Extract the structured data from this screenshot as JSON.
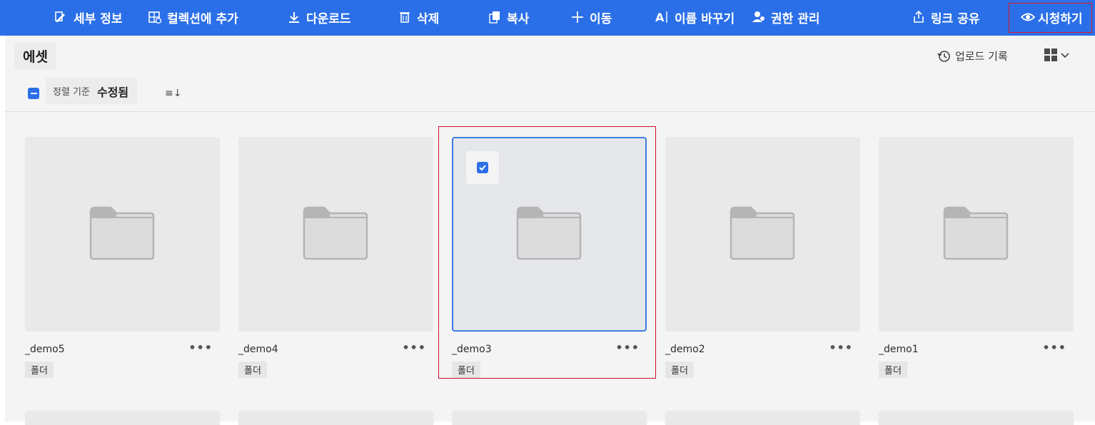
{
  "actionbar": {
    "details": "세부 정보",
    "add_to_collection": "컬렉션에 추가",
    "download": "다운로드",
    "delete": "삭제",
    "copy": "복사",
    "move": "이동",
    "rename": "이름 바꾸기",
    "permissions": "권한 관리",
    "share_link": "링크 공유",
    "view": "시청하기"
  },
  "page": {
    "title": "에셋",
    "upload_history": "업로드 기록",
    "sort_label": "정렬 기준",
    "sort_value": "수정됨",
    "sort_direction": "≡↓"
  },
  "cards": [
    {
      "name": "_demo5",
      "type": "폴더",
      "more": "•••",
      "selected": false
    },
    {
      "name": "_demo4",
      "type": "폴더",
      "more": "•••",
      "selected": false
    },
    {
      "name": "_demo3",
      "type": "폴더",
      "more": "•••",
      "selected": true
    },
    {
      "name": "_demo2",
      "type": "폴더",
      "more": "•••",
      "selected": false
    },
    {
      "name": "_demo1",
      "type": "폴더",
      "more": "•••",
      "selected": false
    }
  ],
  "colors": {
    "accent": "#2b6fe8",
    "highlight_outline": "#c8102e"
  },
  "icons": {
    "details": "edit-icon",
    "add_to_collection": "collection-add-icon",
    "download": "download-icon",
    "delete": "trash-icon",
    "copy": "copy-icon",
    "move": "move-icon",
    "rename": "rename-icon",
    "permissions": "users-icon",
    "share_link": "share-icon",
    "view": "eye-icon"
  }
}
